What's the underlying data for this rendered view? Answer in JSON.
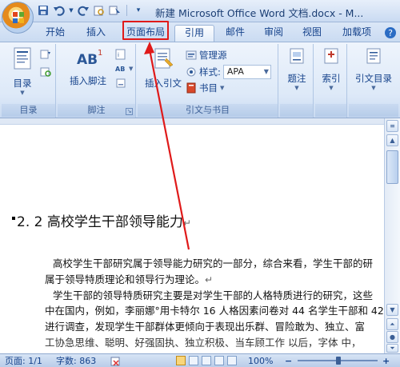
{
  "window": {
    "title": "新建 Microsoft Office Word 文档.docx - M..."
  },
  "quick_access": {
    "items": [
      "save-icon",
      "undo-icon",
      "redo-icon",
      "print-preview-icon",
      "select-icon",
      "customize-icon"
    ]
  },
  "tabs": [
    {
      "label": "开始",
      "active": false
    },
    {
      "label": "插入",
      "active": false
    },
    {
      "label": "页面布局",
      "active": false,
      "highlighted": true
    },
    {
      "label": "引用",
      "active": true
    },
    {
      "label": "邮件",
      "active": false
    },
    {
      "label": "审阅",
      "active": false
    },
    {
      "label": "视图",
      "active": false
    },
    {
      "label": "加载项",
      "active": false
    }
  ],
  "ribbon": {
    "toc_group": {
      "label": "目录",
      "toc_button": "目录"
    },
    "footnote_group": {
      "label": "脚注",
      "insert_footnote": "插入脚注",
      "footnote_badge": "AB",
      "footnote_sup": "1"
    },
    "citation_group": {
      "label": "引文与书目",
      "insert_citation": "插入引文",
      "manage_sources": "管理源",
      "style_label": "样式:",
      "style_value": "APA",
      "bibliography": "书目"
    },
    "caption_button": "题注",
    "index_button": "索引",
    "toa_button": "引文目录"
  },
  "document": {
    "heading": "2. 2 高校学生干部领导能力",
    "paragraph_mark": "↵",
    "lines": [
      "高校学生干部研究属于领导能力研究的一部分，综合来看，学生干部的研",
      "属于领导特质理论和领导行为理论。",
      "学生干部的领导特质研究主要是对学生干部的人格特质进行的研究，这些",
      "中在国内，例如，李丽娜°用卡特尔 16 人格因素问卷对 44 名学生干部和 42",
      "进行调查，发现学生干部群体更倾向于表现出乐群、冒险敢为、独立、富",
      "工协急思维、聪明、好强固执、独立积极、当车顾工作 以后，字体 中，"
    ]
  },
  "statusbar": {
    "page": "页面: 1/1",
    "words": "字数: 863",
    "zoom": "100%",
    "zoom_minus": "−",
    "zoom_plus": "+"
  },
  "colors": {
    "highlight": "#e01a1a",
    "accent": "#15428b"
  }
}
